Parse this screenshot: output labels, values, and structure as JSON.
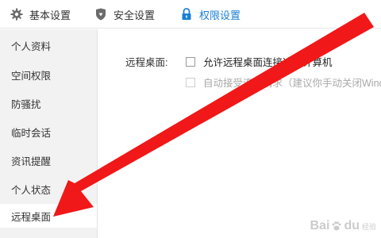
{
  "tabs": [
    {
      "label": "基本设置",
      "icon": "gear-icon",
      "active": false
    },
    {
      "label": "安全设置",
      "icon": "shield-icon",
      "active": false
    },
    {
      "label": "权限设置",
      "icon": "lock-icon",
      "active": true
    }
  ],
  "sidebar": {
    "items": [
      {
        "label": "个人资料"
      },
      {
        "label": "空间权限"
      },
      {
        "label": "防骚扰"
      },
      {
        "label": "临时会话"
      },
      {
        "label": "资讯提醒"
      },
      {
        "label": "个人状态"
      },
      {
        "label": "远程桌面",
        "active": true
      }
    ]
  },
  "remote_desktop": {
    "section_label": "远程桌面:",
    "allow_label": "允许远程桌面连接这台计算机",
    "allow_checked": false,
    "auto_accept_label": "自动接受连接请求（建议你手动关闭Windo",
    "auto_accept_checked": false,
    "auto_accept_disabled": true
  },
  "watermark": {
    "text": "Bai",
    "text2": "du",
    "sub": "经验"
  },
  "colors": {
    "accent": "#1a7fd6",
    "arrow": "#f01818",
    "sidebar_bg": "#f2f2f2"
  }
}
